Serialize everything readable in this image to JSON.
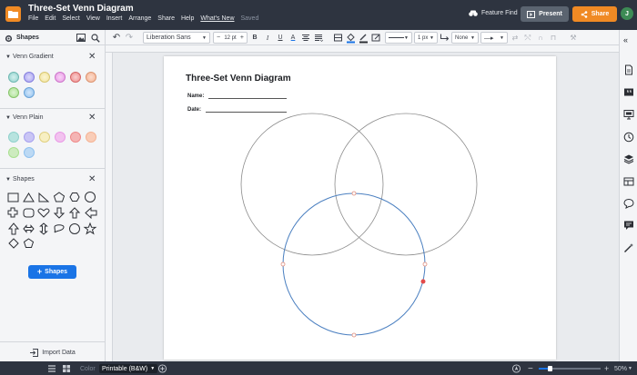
{
  "app": {
    "doc_title": "Three-Set Venn Diagram",
    "menu": [
      "File",
      "Edit",
      "Select",
      "View",
      "Insert",
      "Arrange",
      "Share",
      "Help"
    ],
    "whats_new": "What's New",
    "save_status": "Saved",
    "feature_find": "Feature Find",
    "present": "Present",
    "share": "Share",
    "avatar_initial": "J"
  },
  "toolbar": {
    "font_family": "Liberation Sans",
    "font_size": "12 pt",
    "bold": "B",
    "italic": "I",
    "underline": "U",
    "font_color": "A",
    "line_width": "1 px",
    "arrow_start": "None"
  },
  "left_panel": {
    "title": "Shapes",
    "sections": [
      {
        "title": "Venn Gradient"
      },
      {
        "title": "Venn Plain"
      },
      {
        "title": "Shapes"
      }
    ],
    "shapes_button": "Shapes",
    "import_data": "Import Data",
    "venn_colors": [
      "#8fd1cc",
      "#a7a1ef",
      "#f2e49a",
      "#e99ae6",
      "#ef8a8a",
      "#f5b394",
      "#a9e08f",
      "#8fc1ef"
    ]
  },
  "page": {
    "title": "Three-Set Venn Diagram",
    "name_label": "Name:",
    "date_label": "Date:"
  },
  "statusbar": {
    "color_label": "Color",
    "print_mode": "Printable (B&W)",
    "zoom": "50%",
    "zoom_minus": "−",
    "zoom_plus": "+"
  }
}
